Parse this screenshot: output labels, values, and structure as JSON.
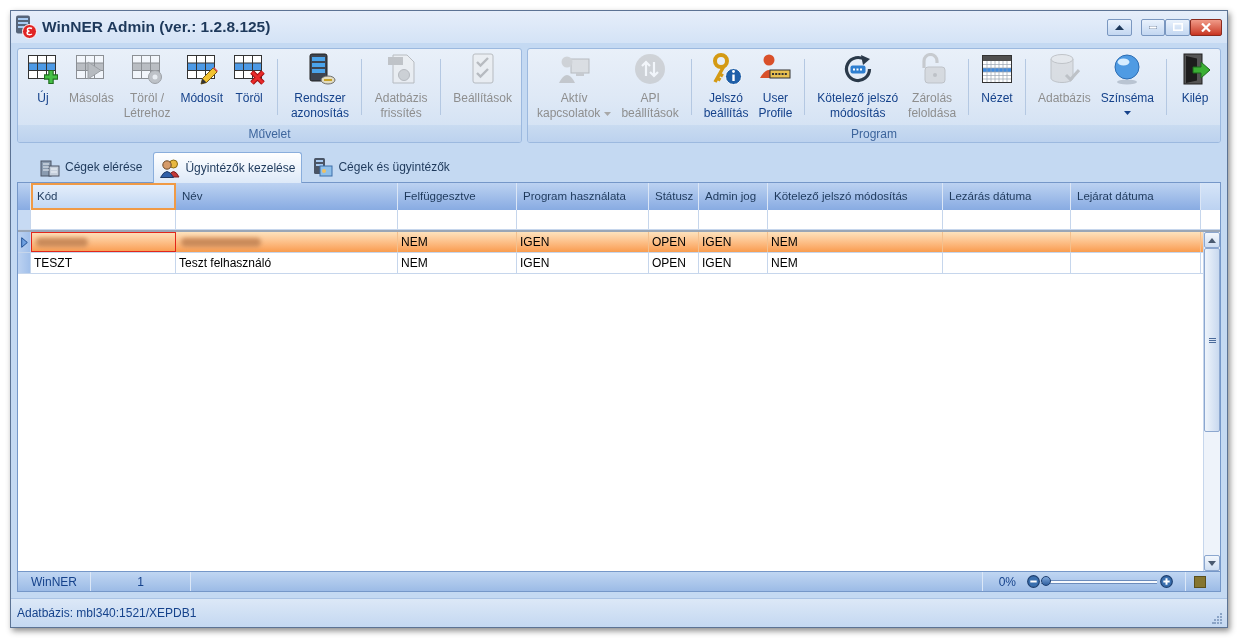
{
  "window": {
    "title": "WinNER Admin (ver.: 1.2.8.125)"
  },
  "ribbon": {
    "groups": [
      {
        "label": "Művelet",
        "clusters": [
          [
            {
              "label": "Új",
              "disabled": false,
              "kind": "button"
            },
            {
              "label": "Másolás",
              "disabled": true,
              "kind": "button"
            },
            {
              "label": "Töröl /\nLétrehoz",
              "disabled": true,
              "kind": "button"
            },
            {
              "label": "Módosít",
              "disabled": false,
              "kind": "button"
            },
            {
              "label": "Töröl",
              "disabled": false,
              "kind": "button"
            }
          ],
          [
            {
              "label": "Rendszer\nazonosítás",
              "disabled": false,
              "kind": "button"
            }
          ],
          [
            {
              "label": "Adatbázis\nfrissítés",
              "disabled": true,
              "kind": "button"
            }
          ],
          [
            {
              "label": "Beállítások",
              "disabled": true,
              "kind": "button"
            }
          ]
        ]
      },
      {
        "label": "Program",
        "clusters": [
          [
            {
              "label": "Aktív\nkapcsolatok",
              "disabled": true,
              "kind": "dropdown"
            },
            {
              "label": "API\nbeállítások",
              "disabled": true,
              "kind": "button"
            }
          ],
          [
            {
              "label": "Jelszó\nbeállítás",
              "disabled": false,
              "kind": "button"
            },
            {
              "label": "User\nProfile",
              "disabled": false,
              "kind": "button"
            }
          ],
          [
            {
              "label": "Kötelező jelszó\nmódosítás",
              "disabled": false,
              "kind": "button"
            },
            {
              "label": "Zárolás\nfeloldása",
              "disabled": true,
              "kind": "button"
            }
          ],
          [
            {
              "label": "Nézet",
              "disabled": false,
              "kind": "button"
            }
          ],
          [
            {
              "label": "Adatbázis",
              "disabled": true,
              "kind": "button"
            },
            {
              "label": "Színséma",
              "disabled": false,
              "kind": "split"
            }
          ],
          [
            {
              "label": "Kilép",
              "disabled": false,
              "kind": "button"
            }
          ]
        ]
      }
    ]
  },
  "tabs": [
    {
      "label": "Cégek elérése",
      "selected": false
    },
    {
      "label": "Ügyintézők kezelése",
      "selected": true
    },
    {
      "label": "Cégek és ügyintézők",
      "selected": false
    }
  ],
  "grid": {
    "columns": [
      {
        "label": "Kód",
        "selected": true
      },
      {
        "label": "Név",
        "selected": false
      },
      {
        "label": "Felfüggesztve",
        "selected": false
      },
      {
        "label": "Program használata",
        "selected": false
      },
      {
        "label": "Státusz",
        "selected": false
      },
      {
        "label": "Admin jog",
        "selected": false
      },
      {
        "label": "Kötelező jelszó módosítás",
        "selected": false
      },
      {
        "label": "Lezárás dátuma",
        "selected": false
      },
      {
        "label": "Lejárat dátuma",
        "selected": false
      }
    ],
    "rows": [
      {
        "selected": true,
        "cells": [
          {
            "kind": "blurred",
            "focused": true
          },
          {
            "kind": "blurred",
            "focused": false
          },
          {
            "kind": "text",
            "text": "NEM",
            "focused": false
          },
          {
            "kind": "text",
            "text": "IGEN",
            "focused": false
          },
          {
            "kind": "text",
            "text": "OPEN",
            "focused": false
          },
          {
            "kind": "text",
            "text": "IGEN",
            "focused": false
          },
          {
            "kind": "text",
            "text": "NEM",
            "focused": false
          }
        ]
      },
      {
        "selected": false,
        "cells": [
          {
            "kind": "text",
            "text": "TESZT",
            "focused": false
          },
          {
            "kind": "text",
            "text": "Teszt felhasználó",
            "focused": false
          },
          {
            "kind": "text",
            "text": "NEM",
            "focused": false
          },
          {
            "kind": "text",
            "text": "IGEN",
            "focused": false
          },
          {
            "kind": "text",
            "text": "OPEN",
            "focused": false
          },
          {
            "kind": "text",
            "text": "IGEN",
            "focused": false
          },
          {
            "kind": "text",
            "text": "NEM",
            "focused": false
          }
        ]
      }
    ]
  },
  "grid_footer": {
    "cells": [
      "WinNER",
      "1"
    ],
    "zoom": {
      "reading": "0%",
      "level": 0
    }
  },
  "status_bar": {
    "text": "Adatbázis: mbl340:1521/XEPDB1"
  }
}
